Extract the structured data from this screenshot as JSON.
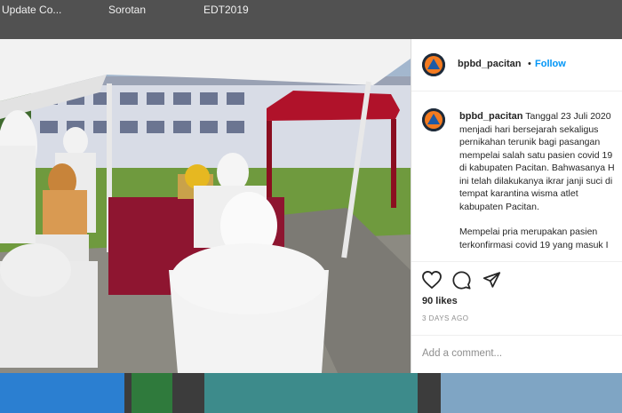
{
  "browser_tabs": [
    "Update Co...",
    "Sorotan",
    "EDT2019"
  ],
  "post": {
    "username": "bpbd_pacitan",
    "separator": "•",
    "follow_label": "Follow",
    "caption_date": "Tanggal 23 Juli 2020",
    "caption_lines": [
      "menjadi hari bersejarah sekaligus",
      "pernikahan terunik bagi pasangan",
      "mempelai salah satu pasien covid 19",
      "di kabupaten Pacitan. Bahwasanya H",
      "ini telah dilakukanya ikrar janji suci di",
      "tempat karantina wisma atlet",
      "kabupaten Pacitan."
    ],
    "caption_lines_2": [
      "Mempelai pria merupakan pasien",
      "terkonfirmasi covid 19 yang masuk I"
    ],
    "likes": "90 likes",
    "time_ago": "3 DAYS AGO",
    "comment_placeholder": "Add a comment..."
  },
  "icons": [
    "heart-icon",
    "comment-icon",
    "share-icon"
  ],
  "colors": {
    "follow": "#0095f6",
    "avatar_bg": "#1d2a3a",
    "avatar_logo": "#f47b20",
    "tent_red": "#b0122a"
  }
}
